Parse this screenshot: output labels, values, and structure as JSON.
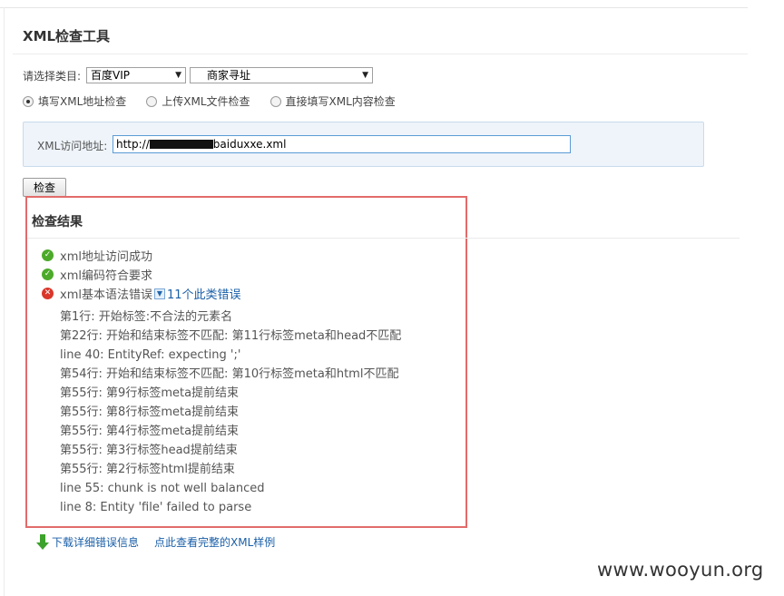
{
  "page": {
    "title": "XML检查工具"
  },
  "form": {
    "category_label": "请选择类目:",
    "category_select": "百度VIP",
    "subcategory_select": "商家寻址",
    "radios": [
      {
        "label": "填写XML地址检查",
        "selected": true
      },
      {
        "label": "上传XML文件检查",
        "selected": false
      },
      {
        "label": "直接填写XML内容检查",
        "selected": false
      }
    ],
    "url_label": "XML访问地址:",
    "url_prefix": "http://",
    "url_suffix": "baiduxxe.xml",
    "check_button": "检查"
  },
  "results": {
    "title": "检查结果",
    "items": [
      {
        "status": "ok",
        "text": "xml地址访问成功"
      },
      {
        "status": "ok",
        "text": "xml编码符合要求"
      },
      {
        "status": "error",
        "text": "xml基本语法错误",
        "count_text": "11个此类错误"
      }
    ],
    "errors": [
      "第1行: 开始标签:不合法的元素名",
      "第22行: 开始和结束标签不匹配: 第11行标签meta和head不匹配",
      "line 40: EntityRef: expecting ';'",
      "第54行: 开始和结束标签不匹配: 第10行标签meta和html不匹配",
      "第55行: 第9行标签meta提前结束",
      "第55行: 第8行标签meta提前结束",
      "第55行: 第4行标签meta提前结束",
      "第55行: 第3行标签head提前结束",
      "第55行: 第2行标签html提前结束",
      "line 55: chunk is not well balanced",
      "line 8: Entity 'file' failed to parse"
    ]
  },
  "links": {
    "download": "下载详细错误信息",
    "sample": "点此查看完整的XML样例"
  },
  "watermark": "www.wooyun.org",
  "colors": {
    "ok": "#4caa2a",
    "error": "#d9372b",
    "link": "#1a5fa8",
    "highlight_frame": "#e26b6b"
  }
}
